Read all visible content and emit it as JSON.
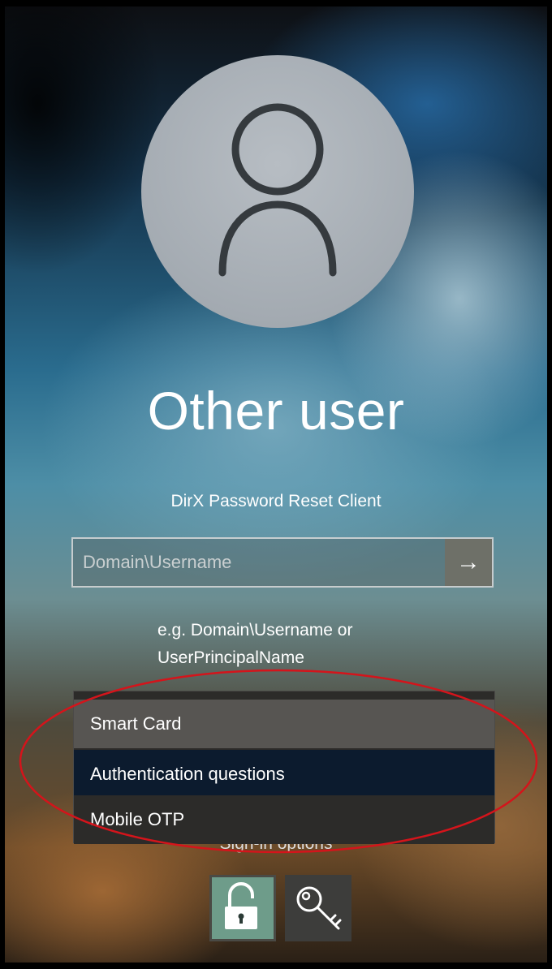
{
  "user": {
    "name": "Other user"
  },
  "provider": {
    "label": "DirX Password Reset Client"
  },
  "username_input": {
    "placeholder": "Domain\\Username",
    "value": ""
  },
  "submit": {
    "arrow": "→"
  },
  "hint": {
    "line1": "e.g. Domain\\Username or",
    "line2": "UserPrincipalName"
  },
  "auth_menu": {
    "items": [
      {
        "label": "Smart Card"
      },
      {
        "label": "Authentication questions",
        "selected": true
      },
      {
        "label": "Mobile OTP"
      }
    ]
  },
  "signin": {
    "label": "Sign-in options",
    "options": [
      {
        "icon": "unlock-icon",
        "selected": true
      },
      {
        "icon": "key-icon",
        "selected": false
      }
    ]
  },
  "colors": {
    "highlight_ellipse": "#d4141b",
    "selected_item": "#0c1b2e"
  }
}
